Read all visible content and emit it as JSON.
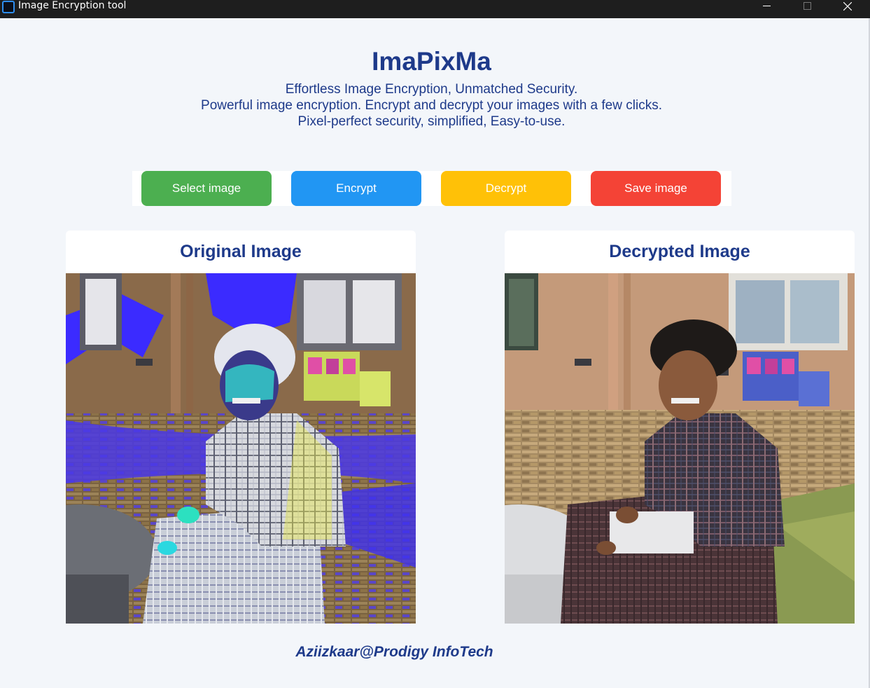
{
  "window": {
    "title": "Image Encryption tool"
  },
  "header": {
    "app_name": "ImaPixMa",
    "tagline_lines": [
      "Effortless Image Encryption, Unmatched Security.",
      "Powerful image encryption. Encrypt and decrypt your images with a few clicks.",
      "Pixel-perfect security, simplified, Easy-to-use."
    ]
  },
  "toolbar": {
    "select_label": "Select image",
    "encrypt_label": "Encrypt",
    "decrypt_label": "Decrypt",
    "save_label": "Save image"
  },
  "panels": {
    "original_title": "Original Image",
    "decrypted_title": "Decrypted Image"
  },
  "footer": {
    "credit": "Aziizkaar@Prodigy InfoTech"
  },
  "colors": {
    "accent": "#1e3a8a",
    "select": "#4caf50",
    "encrypt": "#2196f3",
    "decrypt": "#ffc107",
    "save": "#f44336"
  }
}
